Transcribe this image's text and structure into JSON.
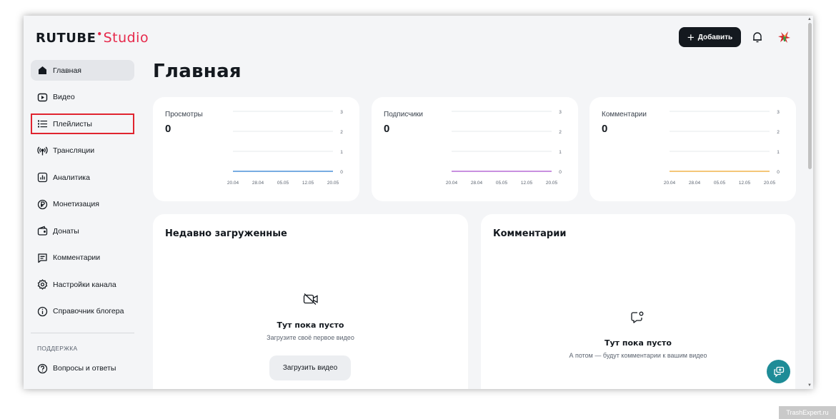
{
  "header": {
    "logo_main": "RUTUBE",
    "logo_dot": "•",
    "logo_studio": "Studio",
    "add_label": "Добавить",
    "add_icon": "+"
  },
  "sidebar": {
    "items": [
      {
        "label": "Главная",
        "icon": "home-icon"
      },
      {
        "label": "Видео",
        "icon": "play-icon"
      },
      {
        "label": "Плейлисты",
        "icon": "list-icon"
      },
      {
        "label": "Трансляции",
        "icon": "broadcast-icon"
      },
      {
        "label": "Аналитика",
        "icon": "analytics-icon"
      },
      {
        "label": "Монетизация",
        "icon": "ruble-icon"
      },
      {
        "label": "Донаты",
        "icon": "wallet-icon"
      },
      {
        "label": "Комментарии",
        "icon": "comment-icon"
      },
      {
        "label": "Настройки канала",
        "icon": "gear-icon"
      },
      {
        "label": "Справочник блогера",
        "icon": "info-icon"
      }
    ],
    "support_caption": "ПОДДЕРЖКА",
    "support_items": [
      {
        "label": "Вопросы и ответы",
        "icon": "question-icon"
      }
    ]
  },
  "main": {
    "title": "Главная",
    "stats": [
      {
        "label": "Просмотры",
        "value": "0",
        "color": "#4a90d9"
      },
      {
        "label": "Подписчики",
        "value": "0",
        "color": "#b56bd6"
      },
      {
        "label": "Комментарии",
        "value": "0",
        "color": "#f0b44c"
      }
    ],
    "recent": {
      "title": "Недавно загруженные",
      "empty_title": "Тут пока пусто",
      "empty_sub": "Загрузите своё первое видео",
      "button": "Загрузить видео"
    },
    "comments": {
      "title": "Комментарии",
      "empty_title": "Тут пока пусто",
      "empty_sub": "А потом — будут комментарии к вашим видео"
    }
  },
  "chart_data": [
    {
      "type": "line",
      "title": "Просмотры",
      "x": [
        "20.04",
        "28.04",
        "05.05",
        "12.05",
        "20.05"
      ],
      "values": [
        0,
        0,
        0,
        0,
        0
      ],
      "ylim": [
        0,
        3
      ],
      "yticks": [
        "3",
        "2",
        "1",
        "0"
      ],
      "color": "#4a90d9"
    },
    {
      "type": "line",
      "title": "Подписчики",
      "x": [
        "20.04",
        "28.04",
        "05.05",
        "12.05",
        "20.05"
      ],
      "values": [
        0,
        0,
        0,
        0,
        0
      ],
      "ylim": [
        0,
        3
      ],
      "yticks": [
        "3",
        "2",
        "1",
        "0"
      ],
      "color": "#b56bd6"
    },
    {
      "type": "line",
      "title": "Комментарии",
      "x": [
        "20.04",
        "28.04",
        "05.05",
        "12.05",
        "20.05"
      ],
      "values": [
        0,
        0,
        0,
        0,
        0
      ],
      "ylim": [
        0,
        3
      ],
      "yticks": [
        "3",
        "2",
        "1",
        "0"
      ],
      "color": "#f0b44c"
    }
  ],
  "watermark": "TrashExpert.ru"
}
